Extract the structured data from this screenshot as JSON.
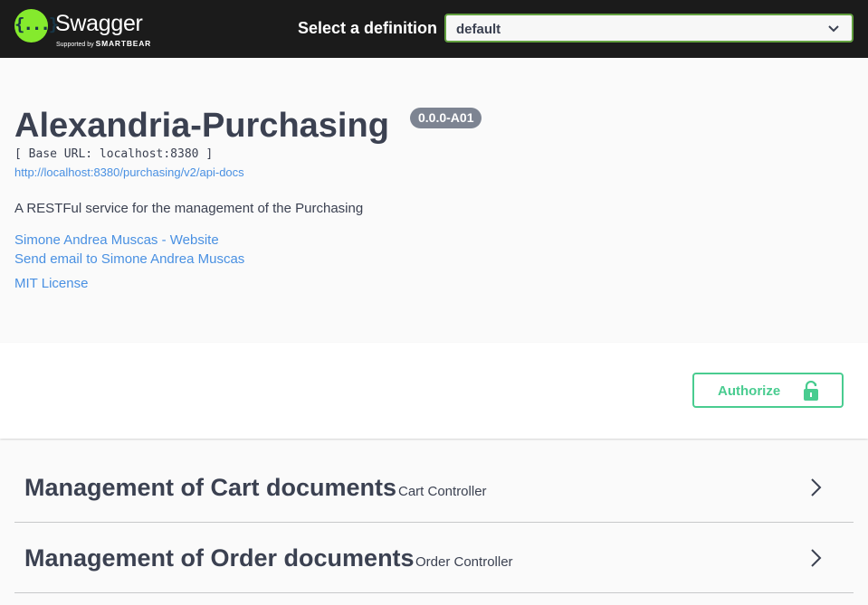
{
  "topbar": {
    "brand": "Swagger",
    "supported_by": "Supported by",
    "company": "SMARTBEAR",
    "logo_glyph": "{...}",
    "select_label": "Select a definition",
    "select_value": "default",
    "accent_color": "#85ea2d"
  },
  "info": {
    "title": "Alexandria-Purchasing",
    "version": "0.0.0-A01",
    "base_url": "[ Base URL: localhost:8380 ]",
    "api_docs_url": "http://localhost:8380/purchasing/v2/api-docs",
    "description": "A RESTFul service for the management of the Purchasing",
    "contact_website": "Simone Andrea Muscas - Website",
    "contact_email": "Send email to Simone Andrea Muscas",
    "license": "MIT License"
  },
  "scheme": {
    "authorize_label": "Authorize",
    "authorize_icon": "unlock-icon",
    "authorize_color": "#49cc90"
  },
  "tags": [
    {
      "name": "Management of Cart documents",
      "description": "Cart Controller"
    },
    {
      "name": "Management of Order documents",
      "description": "Order Controller"
    }
  ]
}
